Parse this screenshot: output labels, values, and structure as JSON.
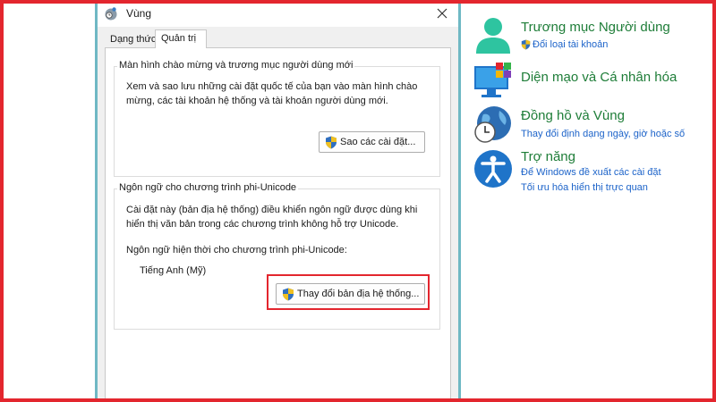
{
  "dialog": {
    "title": "Vùng",
    "tabs": [
      {
        "label": "Dạng thức"
      },
      {
        "label": "Quản trị"
      }
    ],
    "welcome_section": {
      "title": "Màn hình chào mừng và trương mục người dùng mới",
      "description": "Xem và sao lưu những cài đặt quốc tế của bạn vào màn hình chào mừng, các tài khoản hệ thống và tài khoản người dùng mới.",
      "copy_button": "Sao các cài đặt..."
    },
    "non_unicode_section": {
      "title": "Ngôn ngữ cho chương trình phi-Unicode",
      "description": "Cài đặt này (bản địa hệ thống) điều khiển ngôn ngữ được dùng khi hiển thị văn bản trong các chương trình không hỗ trợ Unicode.",
      "current_label": "Ngôn ngữ hiện thời cho chương trình phi-Unicode:",
      "current_value": "Tiếng Anh (Mỹ)",
      "change_button": "Thay đổi bản địa hệ thống..."
    }
  },
  "control_panel": {
    "user_accounts": {
      "title": "Trương mục Người dùng",
      "links": [
        "Đổi loại tài khoản"
      ]
    },
    "appearance": {
      "title": "Diện mạo và Cá nhân hóa",
      "links": []
    },
    "clock_region": {
      "title": "Đồng hồ và Vùng",
      "links": [
        "Thay đổi định dạng ngày, giờ hoặc số"
      ]
    },
    "accessibility": {
      "title": "Trợ năng",
      "links": [
        "Để Windows đề xuất các cài đặt",
        "Tối ưu hóa hiển thị trực quan"
      ]
    }
  },
  "colors": {
    "highlight": "#e3262e",
    "category_title": "#1e7d38",
    "link": "#1c63c9"
  }
}
